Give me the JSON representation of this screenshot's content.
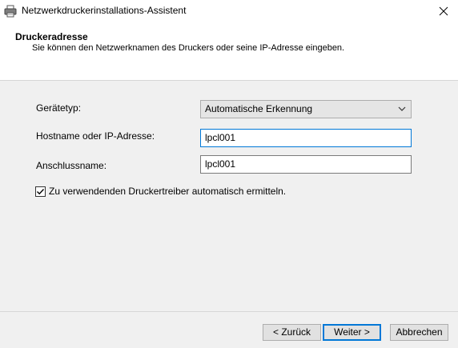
{
  "window": {
    "title": "Netzwerkdruckerinstallations-Assistent",
    "icon": "printer-icon",
    "close_icon": "close-icon"
  },
  "header": {
    "title": "Druckeradresse",
    "subtitle": "Sie können den Netzwerknamen des Druckers oder seine IP-Adresse eingeben."
  },
  "form": {
    "device_type_label": "Gerätetyp:",
    "device_type_value": "Automatische Erkennung",
    "hostname_label": "Hostname oder IP-Adresse:",
    "hostname_value": "lpcl001",
    "portname_label": "Anschlussname:",
    "portname_value": "lpcl001",
    "auto_driver_label": "Zu verwendenden Druckertreiber automatisch ermitteln.",
    "auto_driver_checked": true
  },
  "buttons": {
    "back": "< Zurück",
    "next": "Weiter >",
    "cancel": "Abbrechen"
  },
  "colors": {
    "accent": "#0078d7",
    "background": "#f0f0f0",
    "header_background": "#ffffff"
  }
}
